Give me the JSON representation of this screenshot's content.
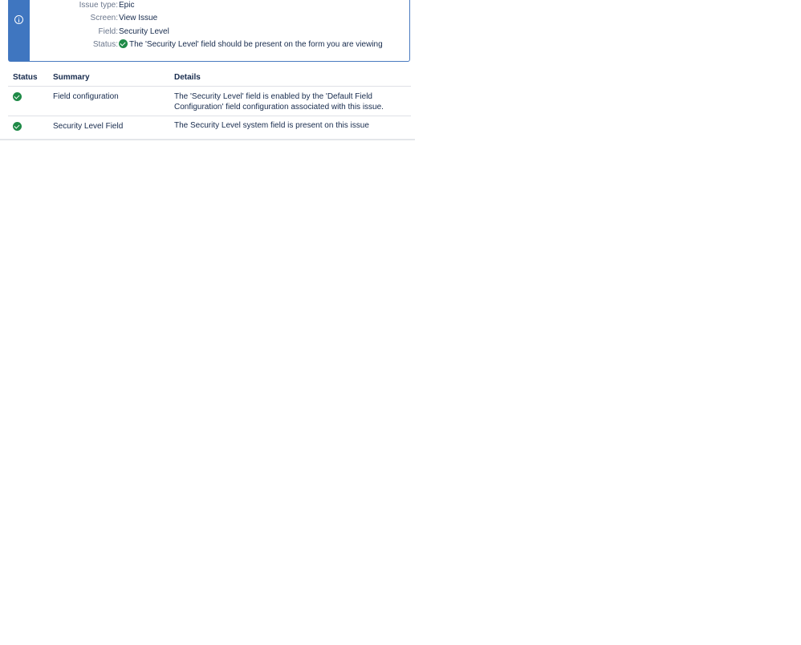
{
  "panel": {
    "rows": [
      {
        "label": "Issue type:",
        "value": "Epic"
      },
      {
        "label": "Screen:",
        "value": "View Issue"
      },
      {
        "label": "Field:",
        "value": "Security Level"
      },
      {
        "label": "Status:",
        "value": "The 'Security Level' field should be present on the form you are viewing"
      }
    ],
    "icon": "info-icon",
    "status_icon": "check-circle-icon"
  },
  "table": {
    "headers": {
      "status": "Status",
      "summary": "Summary",
      "details": "Details"
    },
    "rows": [
      {
        "status_icon": "check-circle-icon",
        "summary": "Field configuration",
        "details": "The 'Security Level' field is enabled by the 'Default Field Configuration' field configuration associated with this issue."
      },
      {
        "status_icon": "check-circle-icon",
        "summary": "Security Level Field",
        "details": "The Security Level system field is present on this issue"
      }
    ]
  },
  "colors": {
    "accent": "#3f76c0",
    "success": "#1f8a47",
    "label": "#6b778c",
    "text": "#172b4d",
    "divider": "#dfe1e6"
  }
}
